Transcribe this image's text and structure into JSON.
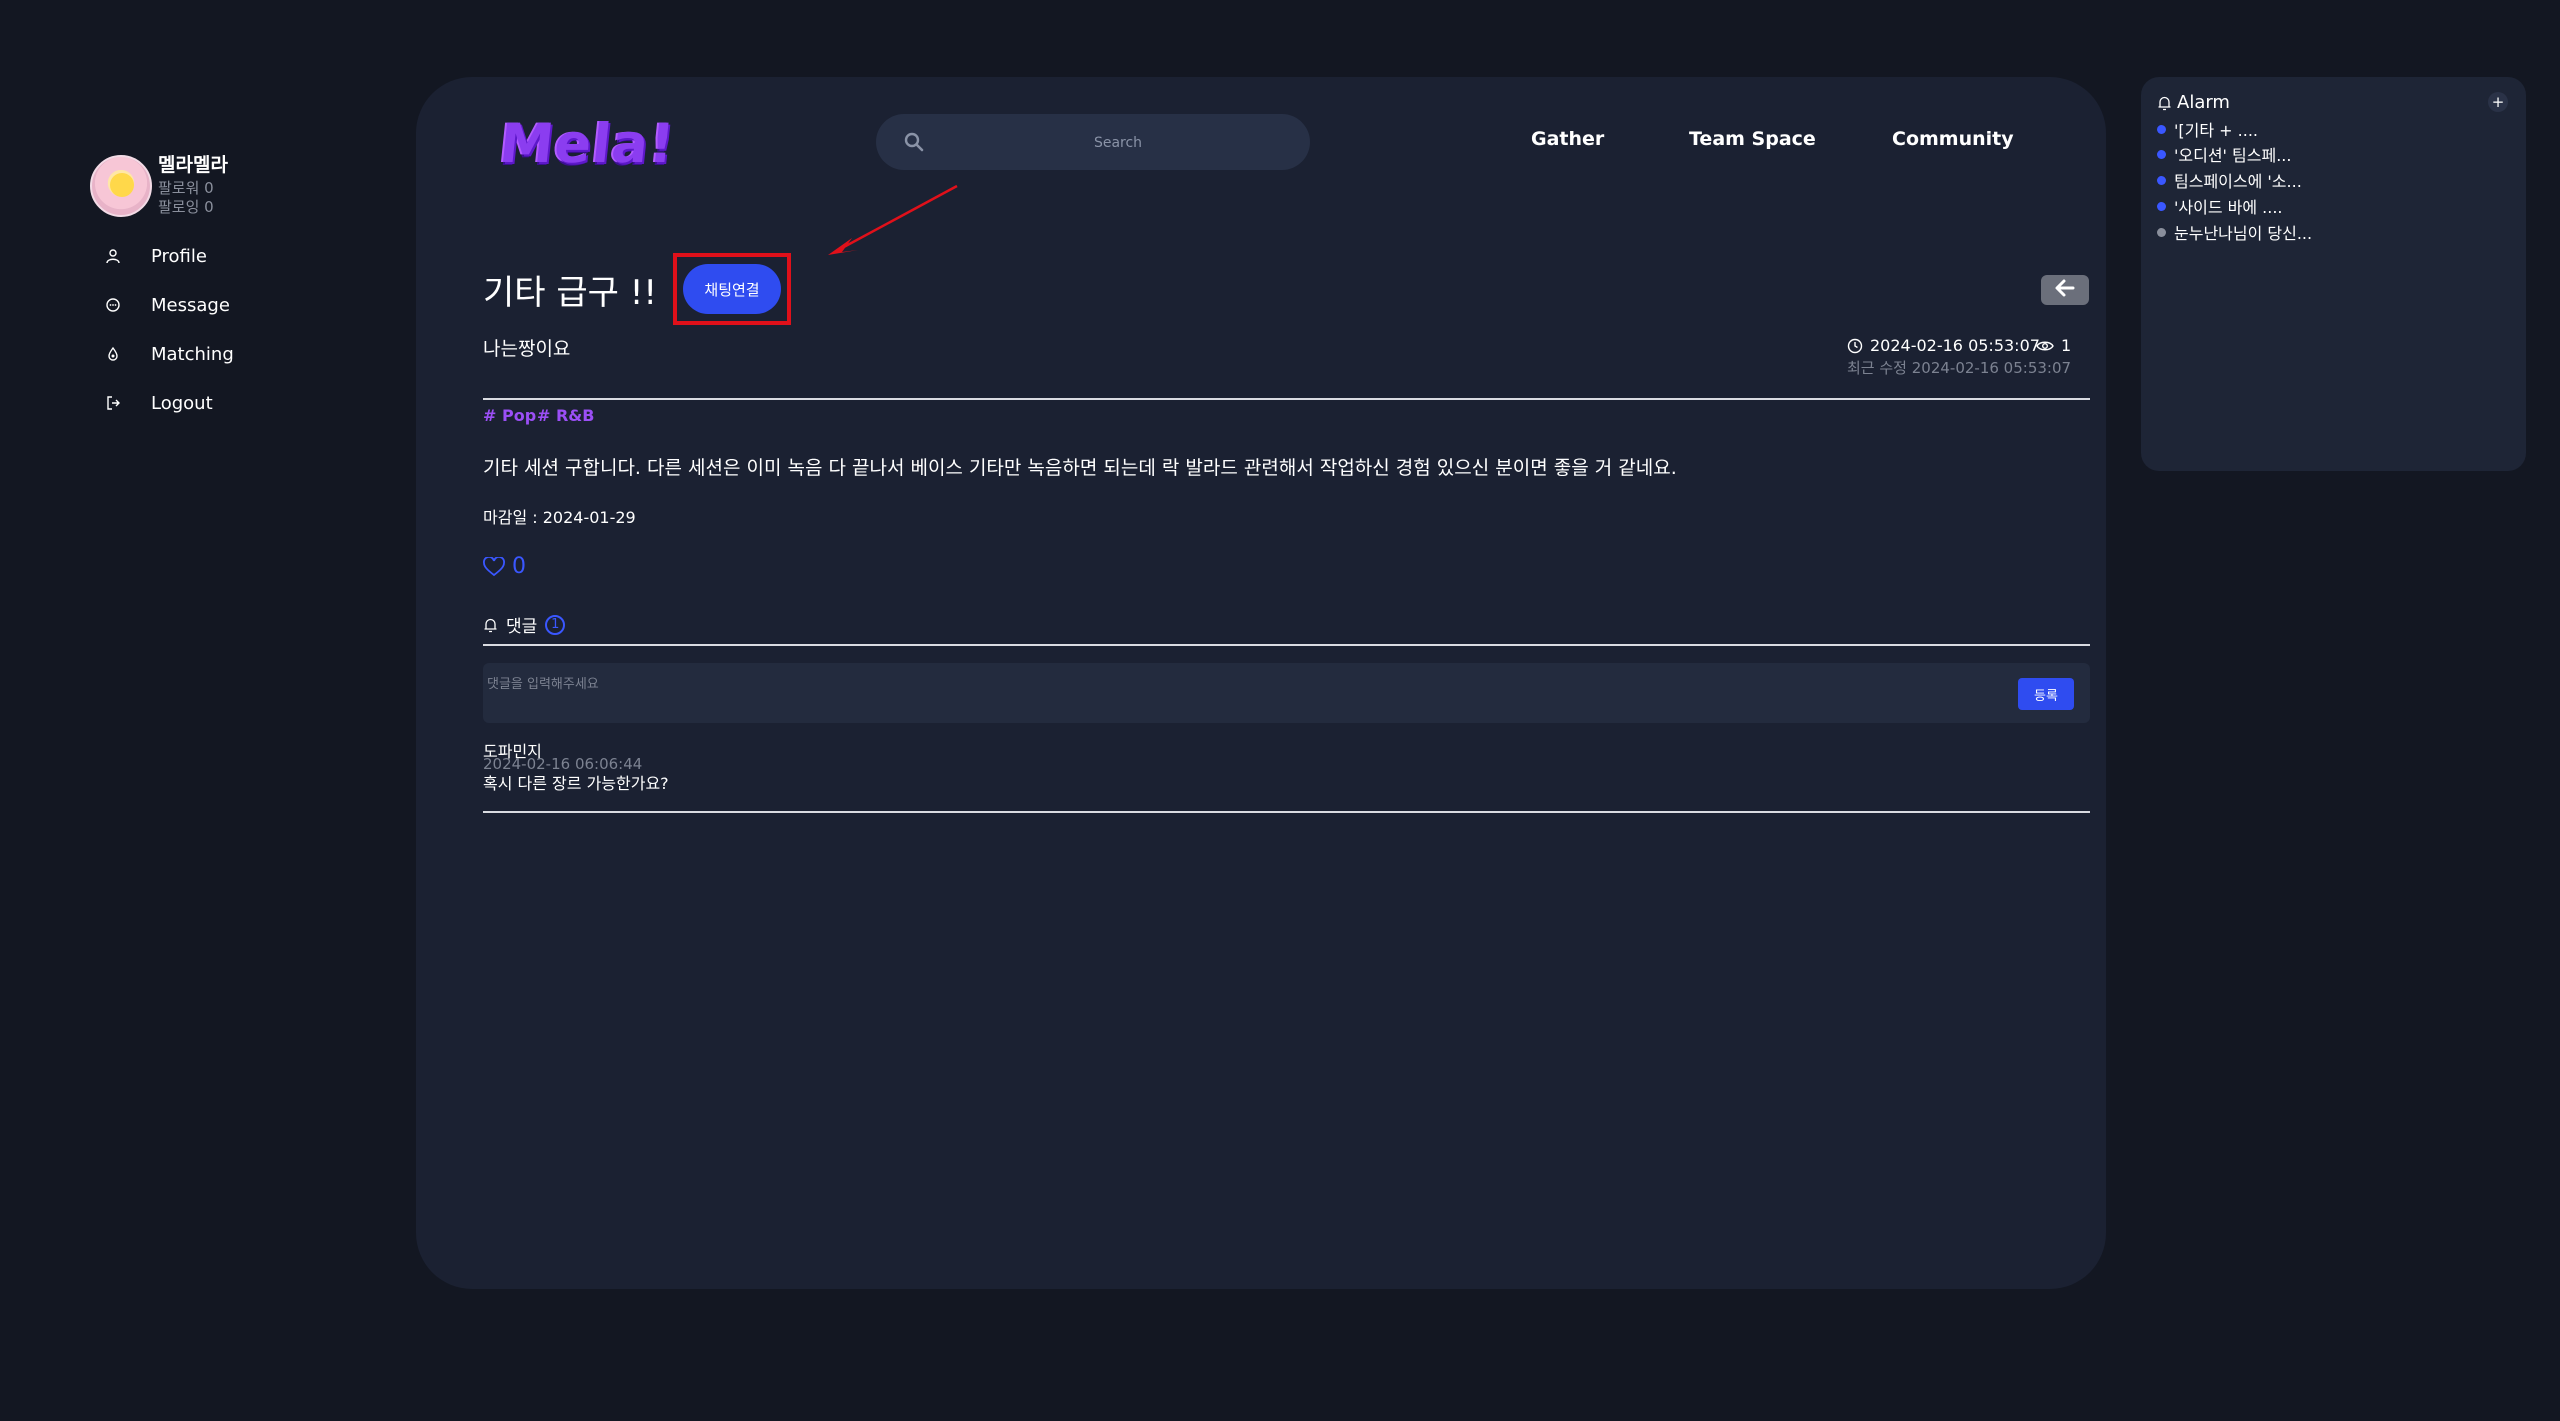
{
  "colors": {
    "accent": "#2f4cf0",
    "tag": "#9b4ff6",
    "alarm_unread": "#3a57ff",
    "alarm_read": "#8a8f9c",
    "highlight": "#e0101a"
  },
  "profile": {
    "username": "멜라멜라",
    "followers": "팔로워 0",
    "following": "팔로잉 0"
  },
  "sidebar": {
    "items": [
      {
        "label": "Profile",
        "icon": "user-icon"
      },
      {
        "label": "Message",
        "icon": "message-icon"
      },
      {
        "label": "Matching",
        "icon": "matching-icon"
      },
      {
        "label": "Logout",
        "icon": "logout-icon"
      }
    ]
  },
  "header": {
    "logo": "Mela!",
    "search_placeholder": "Search",
    "nav": [
      "Gather",
      "Team Space",
      "Community"
    ]
  },
  "post": {
    "title": "기타 급구 !!",
    "chat_button": "채팅연결",
    "author": "나는짱이요",
    "date": "2024-02-16 05:53:07",
    "views": "1",
    "edited": "최근 수정 2024-02-16 05:53:07",
    "tags": [
      "# Pop",
      "# R&B"
    ],
    "body": "기타 세션 구합니다. 다른 세션은 이미 녹음 다 끝나서 베이스 기타만 녹음하면 되는데 락 발라드 관련해서 작업하신 경험 있으신 분이면 좋을 거 같네요.",
    "deadline": "마감일 : 2024-01-29",
    "likes": "0"
  },
  "comments": {
    "header": "댓글",
    "count": "1",
    "placeholder": "댓글을 입력해주세요",
    "submit": "등록",
    "items": [
      {
        "author": "도파민지",
        "date": "2024-02-16 06:06:44",
        "text": "혹시 다른 장르 가능한가요?"
      }
    ]
  },
  "alarm": {
    "title": "Alarm",
    "add": "+",
    "items": [
      {
        "text": "'[기타 + ....",
        "read": false
      },
      {
        "text": "'오디션' 팀스페...",
        "read": false
      },
      {
        "text": "팀스페이스에 '소...",
        "read": false
      },
      {
        "text": "'사이드 바에 ....",
        "read": false
      },
      {
        "text": "눈누난나님이 당신...",
        "read": true
      }
    ]
  }
}
